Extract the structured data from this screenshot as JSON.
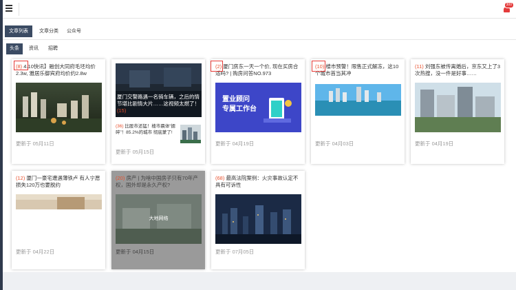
{
  "topbar": {
    "notification_count": "300"
  },
  "tabs": [
    {
      "label": "文章列表",
      "active": true
    },
    {
      "label": "文章分类",
      "active": false
    },
    {
      "label": "公众号",
      "active": false
    }
  ],
  "subtabs": [
    {
      "label": "头条",
      "active": true
    },
    {
      "label": "资讯",
      "active": false
    },
    {
      "label": "招聘",
      "active": false
    }
  ],
  "cards": [
    {
      "count": "(8)",
      "title": "4.10快讯】融创大同府毛坯均价2.3w, 雅居乐御宾府均价约2.8w",
      "date": "更新于 05月11日"
    },
    {
      "count": "(15)",
      "title": "厦门交警路遇一名骑车辆，之后的情节堪比剧情大片……这视频太燃了！",
      "sub_count": "(36)",
      "sub_title": "比股市还猛！楼市晨体“摁碎”！85.2%的城市 彻底蒙了!",
      "date": "更新于 05月15日"
    },
    {
      "count": "(2)",
      "title": "厦门房东一天一个价, 现在买房合适吗? | 购房问答NO.973",
      "banner_line1": "置业顾问",
      "banner_line2": "专属工作台",
      "date": "更新于 04月19日"
    },
    {
      "count": "(10)",
      "title": "楼市预警！限售正式解冻，这10个城市首当其冲",
      "date": "更新于 04月03日"
    },
    {
      "count": "(11)",
      "title": "刘强东被传离婚后，京东又上了3次热搜，没一件是好事……",
      "date": "更新于 04月19日"
    },
    {
      "count": "(12)",
      "title": "厦门一豪宅遭遇薄铁卢 有人宁愿损失120万也要脱约",
      "date": "更新于 04月22日"
    },
    {
      "count": "(20)",
      "title": "房产 | 为啥中国房子只有70年产权，国外却是永久产权?",
      "watermark": "大地网络",
      "date": "更新于 04月15日"
    },
    {
      "count": "(68)",
      "title": "最高法院案例：火灾事故认定不具有可诉性",
      "date": "更新于 07月05日"
    }
  ],
  "colors": {
    "accent": "#3b4b63",
    "count": "#e8502c",
    "highlight": "#e53935"
  },
  "icons": [
    "menu-icon",
    "bell-icon"
  ]
}
